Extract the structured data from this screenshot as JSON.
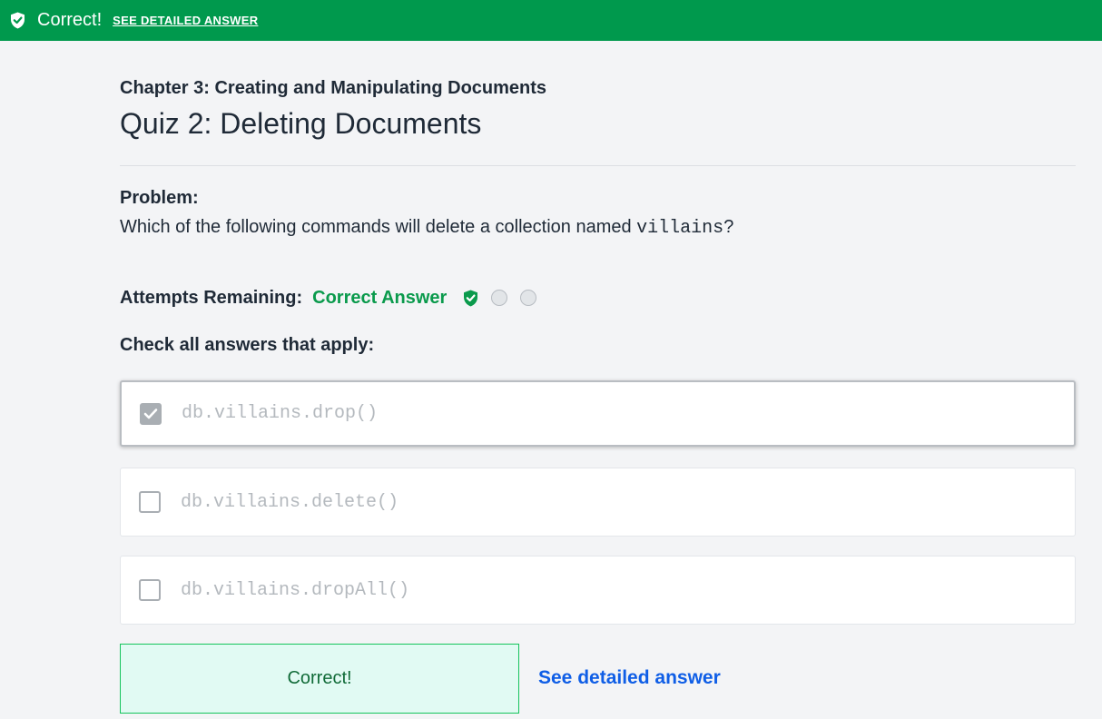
{
  "banner": {
    "status": "Correct!",
    "link_label": "SEE DETAILED ANSWER",
    "icon": "shield-check-icon",
    "background_color": "#00994d"
  },
  "header": {
    "chapter": "Chapter 3: Creating and Manipulating Documents",
    "quiz_title": "Quiz 2: Deleting Documents"
  },
  "problem": {
    "label": "Problem:",
    "text_before": "Which of the following commands will delete a collection named ",
    "code": "villains",
    "text_after": "?"
  },
  "attempts": {
    "label": "Attempts Remaining:",
    "status": "Correct Answer",
    "status_color": "#0a9a4c",
    "indicators": [
      "shield-check-icon",
      "empty-circle",
      "empty-circle"
    ]
  },
  "instructions": "Check all answers that apply:",
  "options": [
    {
      "text": "db.villains.drop()",
      "checked": true
    },
    {
      "text": "db.villains.delete()",
      "checked": false
    },
    {
      "text": "db.villains.dropAll()",
      "checked": false
    }
  ],
  "footer": {
    "result_label": "Correct!",
    "detail_link": "See detailed answer",
    "link_color": "#0f5ee6"
  }
}
